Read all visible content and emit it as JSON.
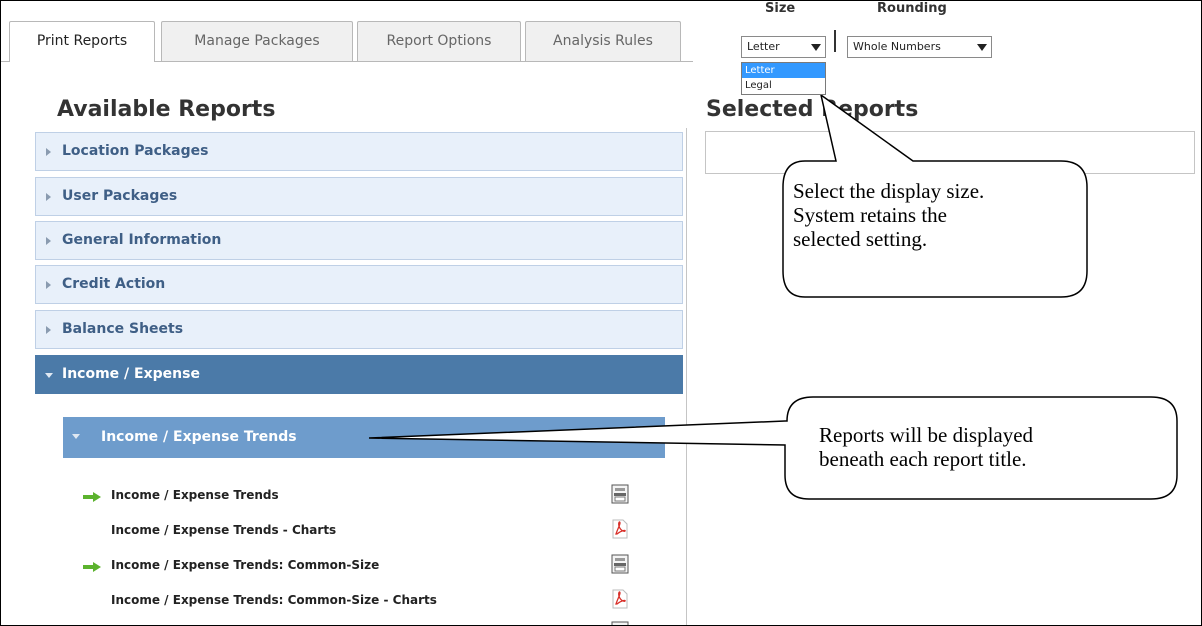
{
  "tabs": [
    {
      "label": "Print Reports",
      "active": true
    },
    {
      "label": "Manage Packages",
      "active": false
    },
    {
      "label": "Report Options",
      "active": false
    },
    {
      "label": "Analysis Rules",
      "active": false
    }
  ],
  "controls": {
    "size_label": "Size",
    "size_value": "Letter",
    "size_options": [
      "Letter",
      "Legal"
    ],
    "size_highlighted": "Letter",
    "rounding_label": "Rounding",
    "rounding_value": "Whole Numbers"
  },
  "available": {
    "heading": "Available Reports",
    "sections": [
      {
        "label": "Location Packages",
        "open": false
      },
      {
        "label": "User Packages",
        "open": false
      },
      {
        "label": "General Information",
        "open": false
      },
      {
        "label": "Credit Action",
        "open": false
      },
      {
        "label": "Balance Sheets",
        "open": false
      },
      {
        "label": "Income / Expense",
        "open": true
      }
    ],
    "subsection": "Income / Expense Trends",
    "reports": [
      {
        "label": "Income / Expense Trends",
        "arrow": true,
        "action_icon": "printer-icon"
      },
      {
        "label": "Income / Expense Trends - Charts",
        "arrow": false,
        "action_icon": "pdf-icon"
      },
      {
        "label": "Income / Expense Trends: Common-Size",
        "arrow": true,
        "action_icon": "printer-icon"
      },
      {
        "label": "Income / Expense Trends: Common-Size - Charts",
        "arrow": false,
        "action_icon": "pdf-icon"
      }
    ]
  },
  "selected": {
    "heading": "Selected Reports"
  },
  "callouts": {
    "size_note": [
      "Select the display size.",
      "System retains the",
      "selected setting."
    ],
    "reports_note": [
      "Reports will be displayed",
      "beneath each report title."
    ]
  },
  "colors": {
    "accordion_bg": "#e8f0fa",
    "accordion_text": "#3f5f86",
    "accordion_open_bg": "#4b7aa8",
    "subsection_bg": "#6e9ccc",
    "arrow_green": "#5cb32e",
    "pdf_red": "#d9302a",
    "highlight": "#3399ff"
  }
}
